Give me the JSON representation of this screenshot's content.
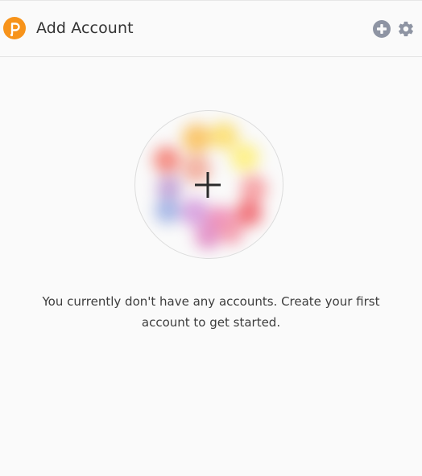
{
  "header": {
    "title": "Add Account",
    "logo_icon": "polkadot-logo-icon",
    "add_icon": "plus-circle-icon",
    "settings_icon": "gear-icon"
  },
  "main": {
    "create_icon": "plus-icon",
    "message": "You currently don't have any accounts. Create your first account to get started."
  },
  "colors": {
    "brand_orange": "#f7931a",
    "icon_gray": "#8e94a3",
    "background": "#fafafa"
  }
}
